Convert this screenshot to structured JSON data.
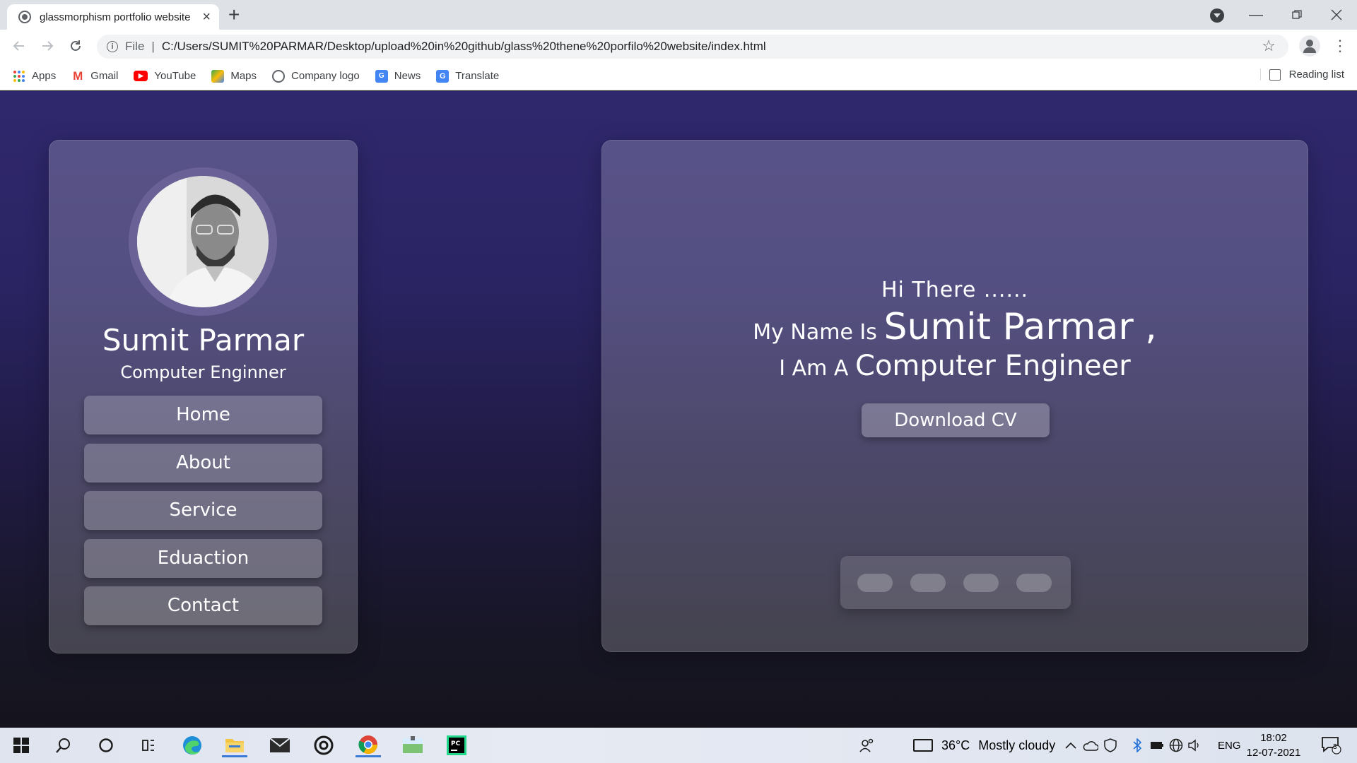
{
  "browser": {
    "tab_title": "glassmorphism portfolio website",
    "tab_close": "×",
    "new_tab": "+",
    "file_label": "File",
    "separator": "|",
    "url": "C:/Users/SUMIT%20PARMAR/Desktop/upload%20in%20github/glass%20thene%20porfilo%20website/index.html",
    "window_controls": [
      "minimize-icon",
      "restore-icon",
      "close-icon"
    ]
  },
  "bookmarks": {
    "items": [
      {
        "label": "Apps",
        "icon": "apps-grid-icon"
      },
      {
        "label": "Gmail",
        "icon": "gmail-icon"
      },
      {
        "label": "YouTube",
        "icon": "youtube-icon"
      },
      {
        "label": "Maps",
        "icon": "maps-icon"
      },
      {
        "label": "Company logo",
        "icon": "globe-icon"
      },
      {
        "label": "News",
        "icon": "news-icon"
      },
      {
        "label": "Translate",
        "icon": "translate-icon"
      }
    ],
    "reading_list": "Reading list"
  },
  "sidebar": {
    "name": "Sumit Parmar",
    "role": "Computer Enginner",
    "menu": [
      "Home",
      "About",
      "Service",
      "Eduaction",
      "Contact"
    ]
  },
  "hero": {
    "line1": "Hi There ......",
    "line2_prefix": "My Name Is",
    "line2_name": "Sumit Parmar ,",
    "line3_prefix": "I Am A",
    "line3_role": "Computer Engineer",
    "cta": "Download CV",
    "social_count": 4
  },
  "taskbar": {
    "weather_temp": "36°C",
    "weather_text": "Mostly cloudy",
    "language": "ENG",
    "time": "18:02",
    "date": "12-07-2021",
    "notification_count": "3"
  },
  "colors": {
    "page_top": "#30286d",
    "page_bottom": "#15141d",
    "chrome_tabstrip": "#dee1e6",
    "accent_blue": "#3a7bd5"
  }
}
